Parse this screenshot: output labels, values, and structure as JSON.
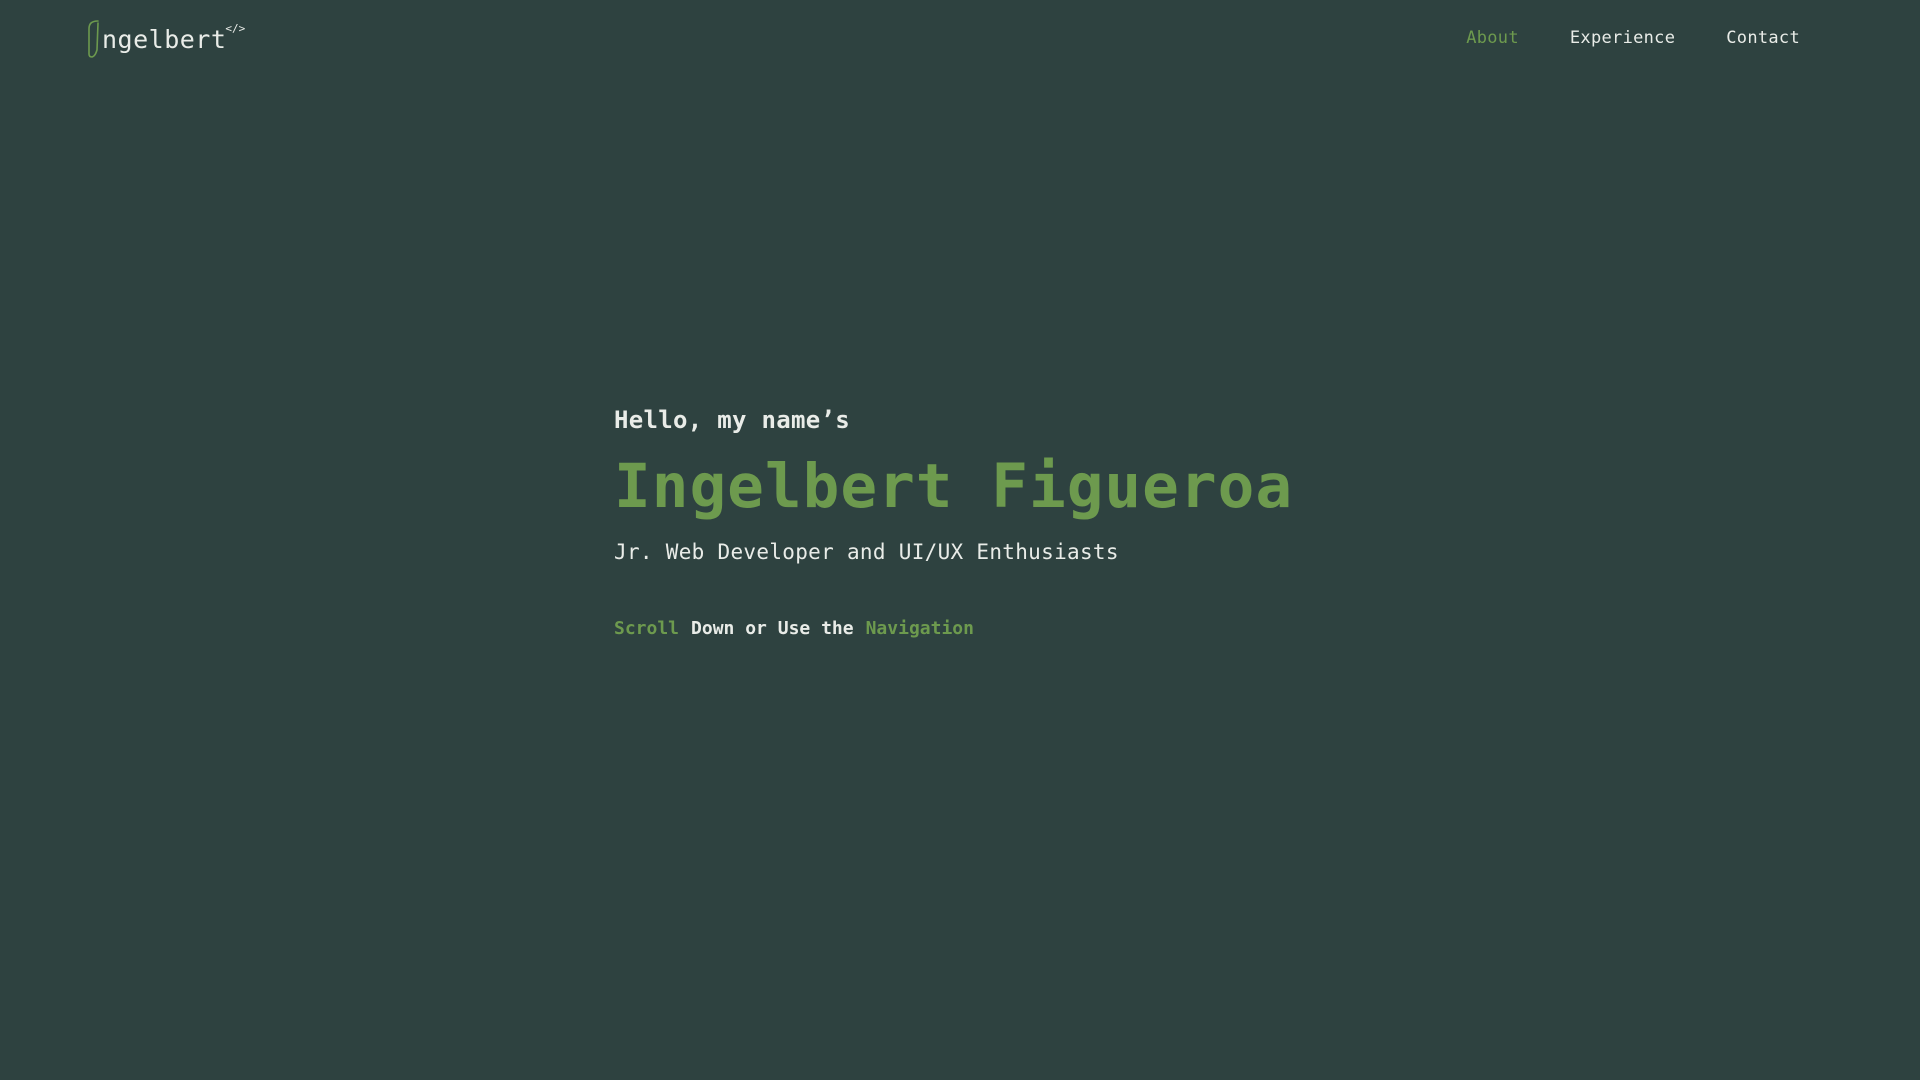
{
  "header": {
    "logo": {
      "text": "ngelbert",
      "code": "</>"
    },
    "nav": [
      {
        "label": "About",
        "active": true
      },
      {
        "label": "Experience",
        "active": false
      },
      {
        "label": "Contact",
        "active": false
      }
    ]
  },
  "hero": {
    "greeting": "Hello, my name’s",
    "name": "Ingelbert Figueroa",
    "role": "Jr. Web Developer and UI/UX Enthusiasts",
    "cta": {
      "scroll": "Scroll",
      "middle": "Down or Use the",
      "navigation": "Navigation"
    }
  },
  "colors": {
    "background": "#2e4240",
    "accent": "#6d9a4e",
    "text": "#e9ece8"
  }
}
